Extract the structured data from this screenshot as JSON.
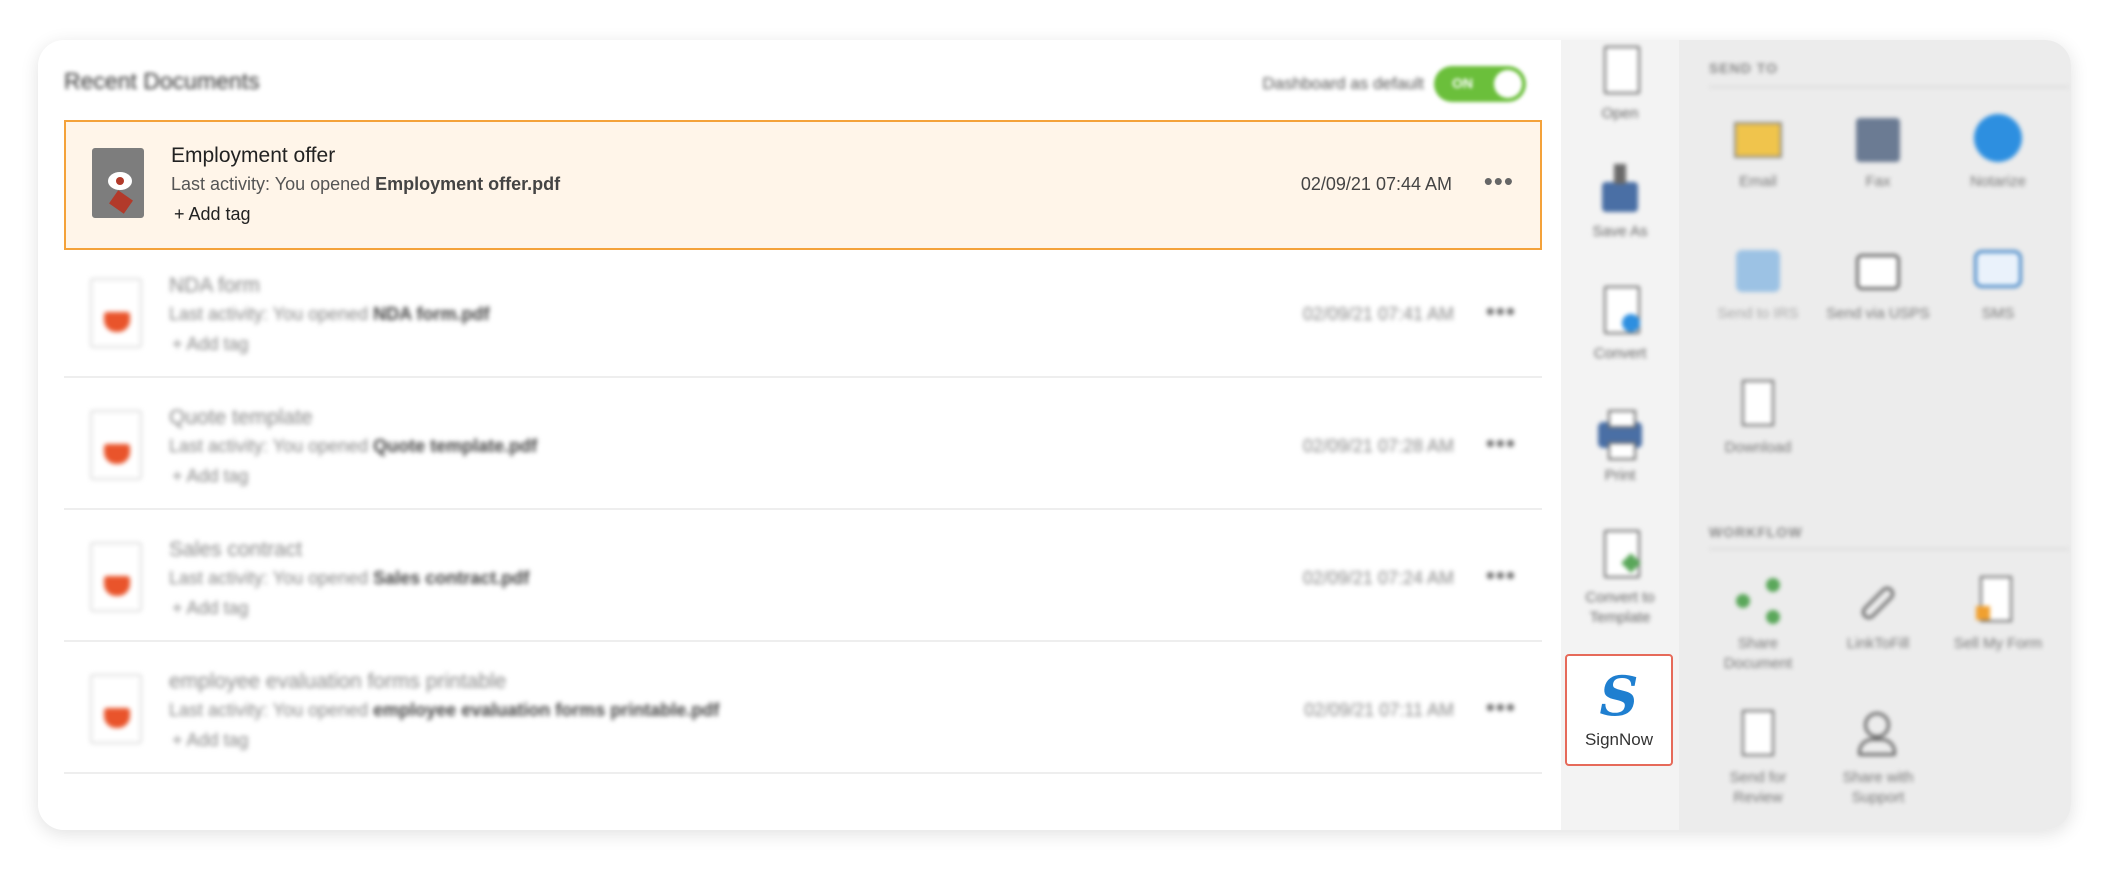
{
  "docs": {
    "title": "Recent Documents",
    "toggle": {
      "label": "Dashboard as default",
      "state": "ON"
    },
    "rows": [
      {
        "name": "Employment offer",
        "activity_prefix": "Last activity: You opened ",
        "file": "Employment offer.pdf",
        "tag": "+ Add tag",
        "date": "02/09/21 07:44 AM"
      },
      {
        "name": "NDA form",
        "activity_prefix": "Last activity: You opened ",
        "file": "NDA form.pdf",
        "tag": "+ Add tag",
        "date": "02/09/21 07:41 AM"
      },
      {
        "name": "Quote template",
        "activity_prefix": "Last activity: You opened ",
        "file": "Quote template.pdf",
        "tag": "+ Add tag",
        "date": "02/09/21 07:28 AM"
      },
      {
        "name": "Sales contract",
        "activity_prefix": "Last activity: You opened ",
        "file": "Sales contract.pdf",
        "tag": "+ Add tag",
        "date": "02/09/21 07:24 AM"
      },
      {
        "name": "employee evaluation forms printable",
        "activity_prefix": "Last activity: You opened ",
        "file": "employee evaluation forms printable.pdf",
        "tag": "+ Add tag",
        "date": "02/09/21 07:11 AM"
      }
    ],
    "more_glyph": "•••"
  },
  "tools": {
    "items": [
      {
        "label": "Open",
        "icon": "open-icon"
      },
      {
        "label": "Save As",
        "icon": "save-as-icon"
      },
      {
        "label": "Convert",
        "icon": "convert-icon"
      },
      {
        "label": "Print",
        "icon": "print-icon"
      },
      {
        "label": "Convert to Template",
        "icon": "convert-to-template-icon"
      }
    ],
    "signnow": {
      "glyph": "S",
      "label": "SignNow"
    }
  },
  "send": {
    "send_to_title": "SEND TO",
    "send_to_items": [
      {
        "label": "Email",
        "icon": "email-icon"
      },
      {
        "label": "Fax",
        "icon": "fax-icon"
      },
      {
        "label": "Notarize",
        "icon": "notarize-icon"
      },
      {
        "label": "Send to IRS",
        "icon": "irs-icon"
      },
      {
        "label": "Send via USPS",
        "icon": "usps-icon"
      },
      {
        "label": "SMS",
        "icon": "sms-icon"
      },
      {
        "label": "Download",
        "icon": "download-icon"
      }
    ],
    "workflow_title": "WORKFLOW",
    "workflow_items": [
      {
        "label": "Share Document",
        "icon": "share-icon"
      },
      {
        "label": "LinkToFill",
        "icon": "link-icon"
      },
      {
        "label": "Sell My Form",
        "icon": "sell-form-icon"
      },
      {
        "label": "Send for Review",
        "icon": "send-review-icon"
      },
      {
        "label": "Share with Support",
        "icon": "support-icon"
      }
    ]
  },
  "colors": {
    "accent_orange": "#f4a23a",
    "toggle_green": "#6bbf3b",
    "signnow_blue": "#1f7fd0",
    "pdf_red": "#e9542b"
  }
}
